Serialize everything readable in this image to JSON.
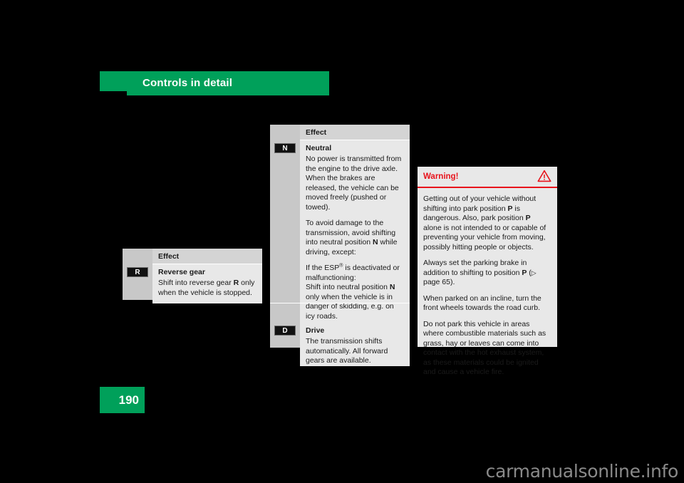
{
  "header": {
    "title": "Controls in detail",
    "band_color": "#00a05a"
  },
  "page_number": "190",
  "tables": [
    {
      "id": "table-left",
      "header_label": "Effect",
      "rows": [
        {
          "badge": "R",
          "badge_icon": "gear-badge-r-icon",
          "title": "Reverse gear",
          "paragraphs": [
            "Shift into reverse gear R only when the vehicle is stopped."
          ]
        }
      ]
    },
    {
      "id": "table-middle",
      "header_label": "Effect",
      "rows": [
        {
          "badge": "N",
          "badge_icon": "gear-badge-n-icon",
          "title": "Neutral",
          "paragraphs": [
            "No power is transmitted from the engine to the drive axle. When the brakes are released, the vehicle can be moved freely (pushed or towed).",
            "To avoid damage to the transmission, avoid shifting into neutral position N while driving, except:",
            "If the ESP® is deactivated or malfunctioning: Shift into neutral position N only when the vehicle is in danger of skidding, e.g. on icy roads."
          ]
        },
        {
          "badge": "D",
          "badge_icon": "gear-badge-d-icon",
          "title": "Drive",
          "paragraphs": [
            "The transmission shifts automatically. All forward gears are available."
          ]
        }
      ]
    }
  ],
  "warning": {
    "title": "Warning!",
    "icon": "warning-triangle-icon",
    "accent_color": "#e8121b",
    "paragraphs": [
      "Getting out of your vehicle without shifting into park position P is dangerous. Also, park position P alone is not intended to or capable of preventing your vehicle from moving, possibly hitting people or objects.",
      "Always set the parking brake in addition to shifting to position P (▷ page 65).",
      "When parked on an incline, turn the front wheels towards the road curb.",
      "Do not park this vehicle in areas where combustible materials such as grass, hay or leaves can come into contact with the hot exhaust system, as these materials could be ignited and cause a vehicle fire."
    ]
  },
  "watermark": "carmanualsonline.info"
}
